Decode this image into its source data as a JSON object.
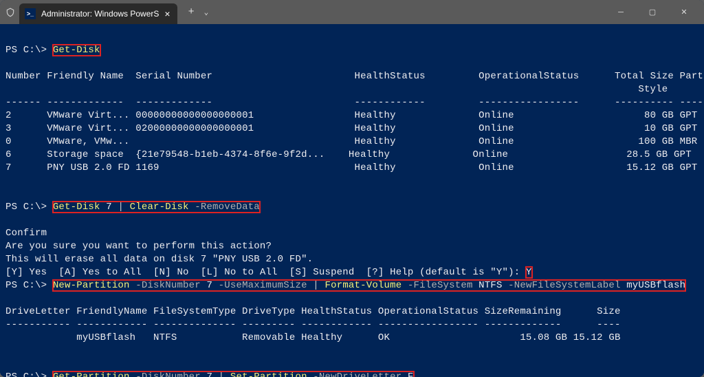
{
  "titlebar": {
    "tab_title": "Administrator: Windows PowerS"
  },
  "prompt": "PS C:\\> ",
  "cmd1": {
    "cmd": "Get-Disk"
  },
  "table1": {
    "headers": {
      "number": "Number",
      "friendly": "Friendly Name",
      "serial": "Serial Number",
      "health": "HealthStatus",
      "oper": "OperationalStatus",
      "total": "Total Size",
      "part": "Partition",
      "style": "Style"
    },
    "sep": {
      "number": "------",
      "friendly": "-------------",
      "serial": "-------------",
      "health": "------------",
      "oper": "-----------------",
      "total": "----------",
      "part": "---------"
    },
    "rows": [
      {
        "num": "2",
        "fn": "VMware Virt...",
        "sn": "00000000000000000001",
        "hs": "Healthy",
        "os": "Online",
        "ts": "80 GB",
        "ps": "GPT"
      },
      {
        "num": "3",
        "fn": "VMware Virt...",
        "sn": "02000000000000000001",
        "hs": "Healthy",
        "os": "Online",
        "ts": "10 GB",
        "ps": "GPT"
      },
      {
        "num": "0",
        "fn": "VMware, VMw...",
        "sn": "",
        "hs": "Healthy",
        "os": "Online",
        "ts": "100 GB",
        "ps": "MBR"
      },
      {
        "num": "6",
        "fn": "Storage space",
        "sn": "{21e79548-b1eb-4374-8f6e-9f2d...",
        "hs": "Healthy",
        "os": "Online",
        "ts": "28.5 GB",
        "ps": "GPT"
      },
      {
        "num": "7",
        "fn": "PNY USB 2.0 FD",
        "sn": "1169",
        "hs": "Healthy",
        "os": "Online",
        "ts": "15.12 GB",
        "ps": "GPT"
      }
    ]
  },
  "cmd2": {
    "c1": "Get-Disk",
    "arg1": " 7 ",
    "pipe": "| ",
    "c2": "Clear-Disk",
    "p1": " -RemoveData"
  },
  "confirm": {
    "title": "Confirm",
    "l1": "Are you sure you want to perform this action?",
    "l2": "This will erase all data on disk 7 \"PNY USB 2.0 FD\".",
    "l3": "[Y] Yes  [A] Yes to All  [N] No  [L] No to All  [S] Suspend  [?] Help (default is \"Y\"): ",
    "answer": "Y"
  },
  "cmd3": {
    "c1": "New-Partition",
    "p1": " -DiskNumber",
    "a1": " 7 ",
    "p2": "-UseMaximumSize",
    "pipe": " | ",
    "c2": "Format-Volume",
    "p3": " -FileSystem",
    "a3": " NTFS ",
    "p4": "-NewFileSystemLabel",
    "a4": " myUSBflash"
  },
  "table2": {
    "headers": "DriveLetter FriendlyName FileSystemType DriveType HealthStatus OperationalStatus SizeRemaining      Size",
    "sep": "----------- ------------ -------------- --------- ------------ ----------------- -------------      ----",
    "row": "            myUSBflash   NTFS           Removable Healthy      OK                      15.08 GB 15.12 GB"
  },
  "cmd4": {
    "c1": "Get-Partition",
    "p1": " -DiskNumber",
    "a1": " 7 ",
    "pipe": "| ",
    "c2": "Set-Partition",
    "p2": " -NewDriveLetter",
    "a2": " F"
  }
}
